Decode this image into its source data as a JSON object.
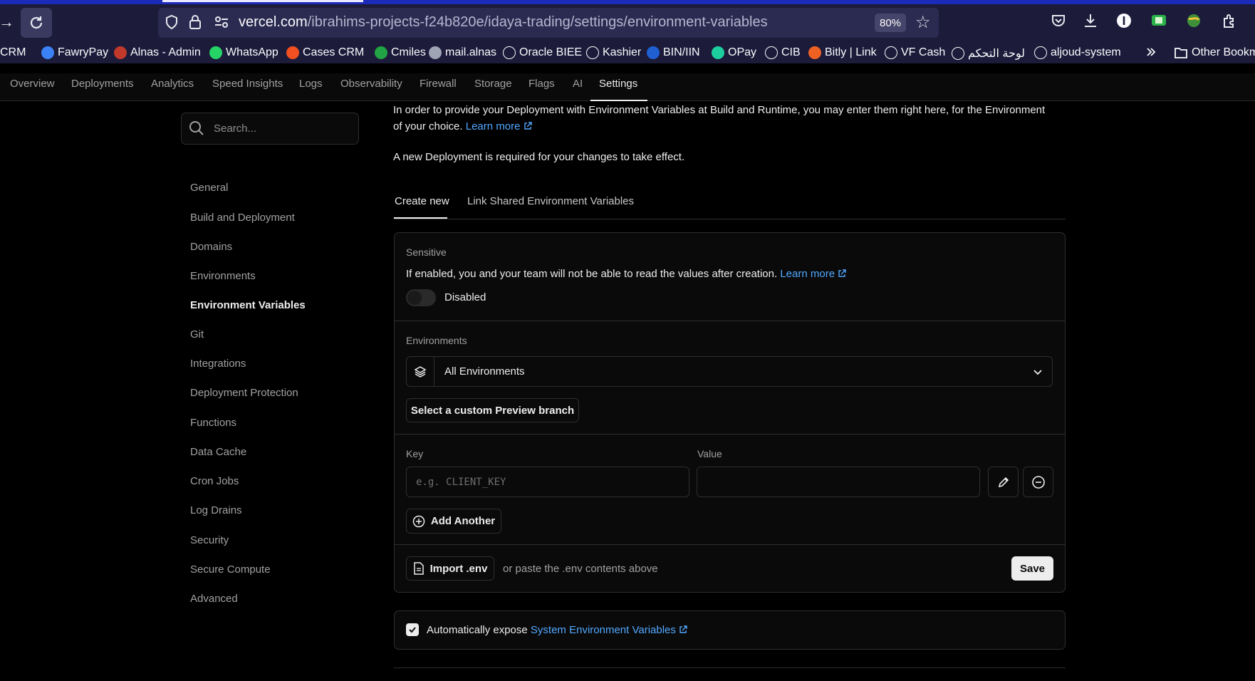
{
  "browser": {
    "url_host": "vercel.com",
    "url_path": "/ibrahims-projects-f24b820e/idaya-trading/settings/environment-variables",
    "zoom": "80%"
  },
  "bookmarks": [
    {
      "label": "CRM",
      "icon": "bookmark-icon",
      "color": "#1f5fd1"
    },
    {
      "label": "FawryPay",
      "icon": "fawrypay-icon",
      "color": "#3b82f6"
    },
    {
      "label": "Alnas - Admin",
      "icon": "alnas-icon",
      "color": "#c0392b"
    },
    {
      "label": "WhatsApp",
      "icon": "whatsapp-icon",
      "color": "#25d366"
    },
    {
      "label": "Cases CRM",
      "icon": "microsoft-icon",
      "color": "#f25022"
    },
    {
      "label": "Cmiles",
      "icon": "cmiles-icon",
      "color": "#22a344"
    },
    {
      "label": "mail.alnas",
      "icon": "mail-icon",
      "color": "#9ea4b4"
    },
    {
      "label": "Oracle BIEE",
      "icon": "globe-icon",
      "color": "#1c1b3a"
    },
    {
      "label": "Kashier",
      "icon": "kashier-icon",
      "color": "#1c1b3a"
    },
    {
      "label": "BIN/IIN",
      "icon": "bin-icon",
      "color": "#1f5fd1"
    },
    {
      "label": "OPay",
      "icon": "opay-icon",
      "color": "#1dcf9f"
    },
    {
      "label": "CIB",
      "icon": "globe-icon",
      "color": "#1c1b3a"
    },
    {
      "label": "Bitly | Link",
      "icon": "bitly-icon",
      "color": "#ee6123"
    },
    {
      "label": "VF Cash",
      "icon": "globe-icon",
      "color": "#1c1b3a"
    },
    {
      "label": "لوحة التحكم",
      "icon": "globe-icon",
      "color": "#1c1b3a"
    },
    {
      "label": "aljoud-system",
      "icon": "globe-icon",
      "color": "#1c1b3a"
    }
  ],
  "other_bookmarks": "Other Bookm",
  "nav_tabs": [
    "Overview",
    "Deployments",
    "Analytics",
    "Speed Insights",
    "Logs",
    "Observability",
    "Firewall",
    "Storage",
    "Flags",
    "AI",
    "Settings"
  ],
  "sidebar": {
    "search_placeholder": "Search...",
    "items": [
      "General",
      "Build and Deployment",
      "Domains",
      "Environments",
      "Environment Variables",
      "Git",
      "Integrations",
      "Deployment Protection",
      "Functions",
      "Data Cache",
      "Cron Jobs",
      "Log Drains",
      "Security",
      "Secure Compute",
      "Advanced"
    ],
    "active": "Environment Variables"
  },
  "main": {
    "intro": "In order to provide your Deployment with Environment Variables at Build and Runtime, you may enter them right here, for the Environment of your choice.",
    "intro_link": "Learn more",
    "redeploy_note": "A new Deployment is required for your changes to take effect.",
    "tabs": [
      "Create new",
      "Link Shared Environment Variables"
    ],
    "sensitive": {
      "label": "Sensitive",
      "description": "If enabled, you and your team will not be able to read the values after creation.",
      "link": "Learn more",
      "toggle_state": "Disabled"
    },
    "environments": {
      "label": "Environments",
      "selected": "All Environments",
      "custom_branch_button": "Select a custom Preview branch"
    },
    "keyvalue": {
      "key_label": "Key",
      "value_label": "Value",
      "key_placeholder": "e.g. CLIENT_KEY",
      "value": "",
      "add_another": "Add Another"
    },
    "footer": {
      "import_button": "Import .env",
      "paste_hint": "or paste the .env contents above",
      "save_button": "Save"
    },
    "expose": {
      "checked": true,
      "text": "Automatically expose",
      "link": "System Environment Variables"
    }
  },
  "colors": {
    "accent_link": "#52a8ff",
    "browser_toolbar": "#1c1b3a",
    "background": "#000000"
  }
}
